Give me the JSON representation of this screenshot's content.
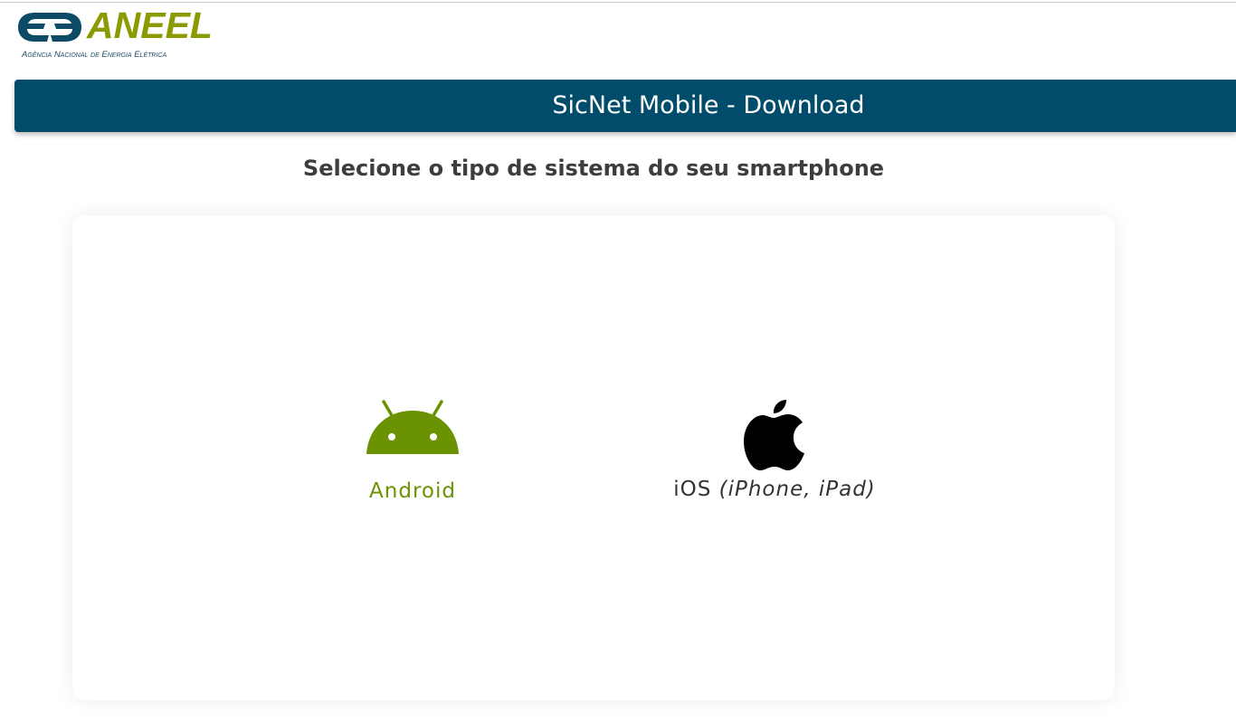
{
  "header": {
    "logo_text": "ANEEL",
    "logo_subtitle": "Agência Nacional de Energia Elétrica",
    "logo_mark_text": "EE"
  },
  "banner": {
    "title": "SicNet Mobile - Download"
  },
  "main": {
    "instruction": "Selecione o tipo de sistema do seu smartphone",
    "options": [
      {
        "label": "Android",
        "icon": "android-icon",
        "color": "#6b9200"
      },
      {
        "label": "iOS",
        "label_detail": "(iPhone, iPad)",
        "icon": "apple-icon",
        "color": "#000000"
      }
    ]
  },
  "colors": {
    "banner_bg": "#004c6a",
    "logo_green": "#8b9a00",
    "logo_blue": "#0c4a66",
    "android_green": "#6b9200"
  }
}
